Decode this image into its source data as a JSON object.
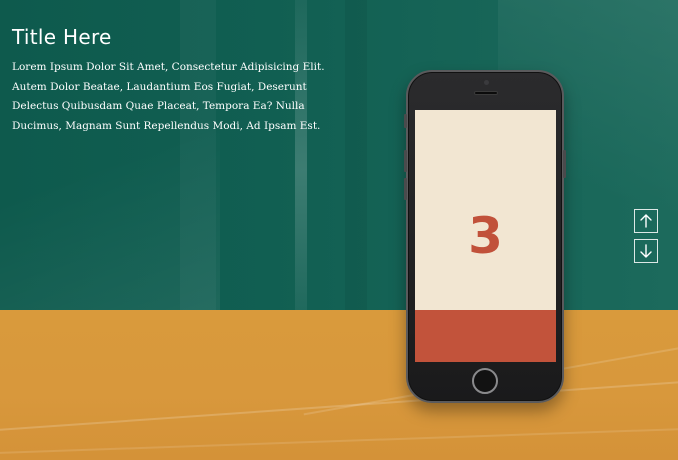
{
  "header": {
    "title": "Title Here",
    "description": "Lorem Ipsum Dolor Sit Amet, Consectetur Adipisicing Elit. Autem Dolor Beatae, Laudantium Eos Fugiat, Deserunt Delectus Quibusdam Quae Placeat, Tempora Ea? Nulla Ducimus, Magnam Sunt Repellendus Modi, Ad Ipsam Est."
  },
  "phone": {
    "slide_number": "3"
  },
  "nav": {
    "up_icon": "arrow-up-icon",
    "down_icon": "arrow-down-icon"
  },
  "colors": {
    "top_background": "#115f52",
    "bottom_background": "#d8983c",
    "screen_background": "#f2e6d2",
    "accent": "#c2533b"
  }
}
